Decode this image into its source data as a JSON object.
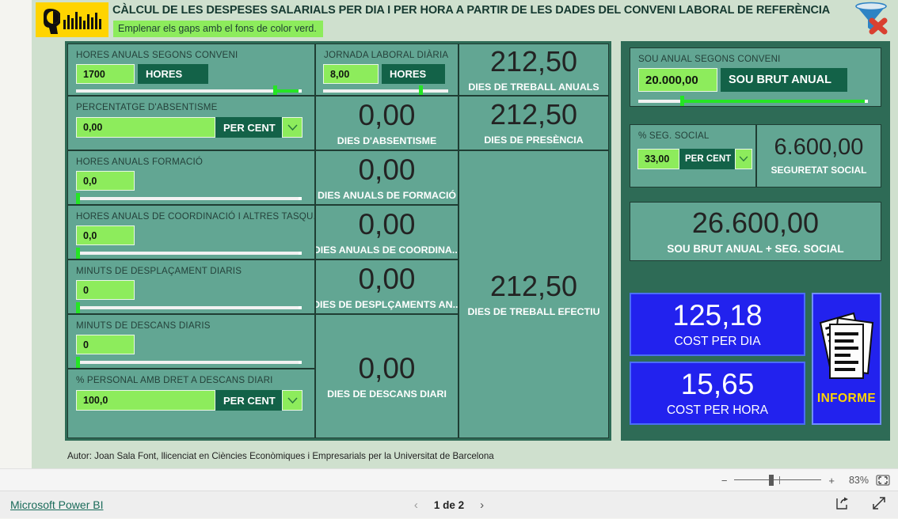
{
  "header": {
    "title": "CÀLCUL DE LES DESPESES SALARIALS PER DIA I PER HORA A PARTIR DE LES DADES DEL CONVENI LABORAL DE REFERÈNCIA",
    "note": "Emplenar els gaps amb el fons de color verd.",
    "filter_icon": "funnel-clear-filter-icon",
    "logo_icon": "megaphone-bar-chart-logo"
  },
  "inputs": {
    "hores_anuals": {
      "label": "HORES ANUALS SEGONS CONVENI",
      "value": "1700",
      "unit": "HORES",
      "slider_pct": 88
    },
    "percentatge_absentisme": {
      "label": "PERCENTATGE D'ABSENTISME",
      "value": "0,00",
      "unit": "PER CENT",
      "caret": "chevron-down-icon"
    },
    "hores_formacio": {
      "label": "HORES ANUALS FORMACIÓ",
      "value": "0,0",
      "slider_pct": 0
    },
    "hores_coordinacio": {
      "label": "HORES ANUALS DE COORDINACIÓ I ALTRES TASQU...",
      "value": "0,0",
      "slider_pct": 0
    },
    "minuts_desplacament": {
      "label": "MINUTS DE DESPLAÇAMENT DIARIS",
      "value": "0",
      "slider_pct": 0
    },
    "minuts_descans": {
      "label": "MINUTS DE DESCANS DIARIS",
      "value": "0",
      "slider_pct": 0
    },
    "personal_descans": {
      "label": "% PERSONAL AMB DRET A DESCANS DIARI",
      "value": "100,0",
      "unit": "PER CENT",
      "caret": "chevron-down-icon"
    },
    "jornada_diaria": {
      "label": "JORNADA LABORAL DIÀRIA",
      "value": "8,00",
      "unit": "HORES",
      "slider_pct": 77
    },
    "sou_anual": {
      "label": "SOU ANUAL SEGONS CONVENI",
      "value": "20.000,00",
      "unit": "SOU BRUT ANUAL",
      "slider_pct": 19
    },
    "seg_social_pct": {
      "label": "% SEG. SOCIAL",
      "value": "33,00",
      "unit": "PER CENT",
      "caret": "chevron-down-icon"
    }
  },
  "kpis": {
    "dies_absentisme": {
      "value": "0,00",
      "label": "DIES D'ABSENTISME"
    },
    "dies_formacio": {
      "value": "0,00",
      "label": "DIES ANUALS DE FORMACIÓ"
    },
    "dies_coordinacio": {
      "value": "0,00",
      "label": "DIES ANUALS DE COORDINA..."
    },
    "dies_desplacament": {
      "value": "0,00",
      "label": "DIES DE DESPLÇAMENTS AN..."
    },
    "dies_descans": {
      "value": "0,00",
      "label": "DIES DE DESCANS DIARI"
    },
    "dies_treball": {
      "value": "212,50",
      "label": "DIES DE TREBALL ANUALS"
    },
    "dies_presencia": {
      "value": "212,50",
      "label": "DIES DE PRESÈNCIA"
    },
    "dies_efectiu": {
      "value": "212,50",
      "label": "DIES DE TREBALL EFECTIU"
    },
    "seguretat_social": {
      "value": "6.600,00",
      "label": "SEGURETAT SOCIAL"
    },
    "sou_mes_ss": {
      "value": "26.600,00",
      "label": "SOU BRUT ANUAL + SEG. SOCIAL"
    },
    "cost_per_dia": {
      "value": "125,18",
      "label": "COST PER DIA"
    },
    "cost_per_hora": {
      "value": "15,65",
      "label": "COST PER HORA"
    }
  },
  "informe": {
    "label": "INFORME",
    "icon": "documents-report-icon"
  },
  "author": "Autor: Joan Sala Font, llicenciat en Ciències Econòmiques i Empresarials per la Universitat de Barcelona",
  "chrome": {
    "zoom_minus": "−",
    "zoom_plus": "+",
    "zoom_level": "83%",
    "fit_icon": "fit-to-page-icon",
    "powerbi_link": "Microsoft Power BI",
    "prev_page_icon": "chevron-left-icon",
    "next_page_icon": "chevron-right-icon",
    "page_indicator": "1 de 2",
    "share_icon": "share-icon",
    "fullscreen_icon": "fullscreen-icon"
  },
  "colors": {
    "panel_dark_green": "#2e6b56",
    "card_green": "#62a693",
    "gap_green": "#8dec5c",
    "unit_green": "#136248",
    "blue_card": "#2222ee",
    "accent_yellow": "#ffd400"
  }
}
